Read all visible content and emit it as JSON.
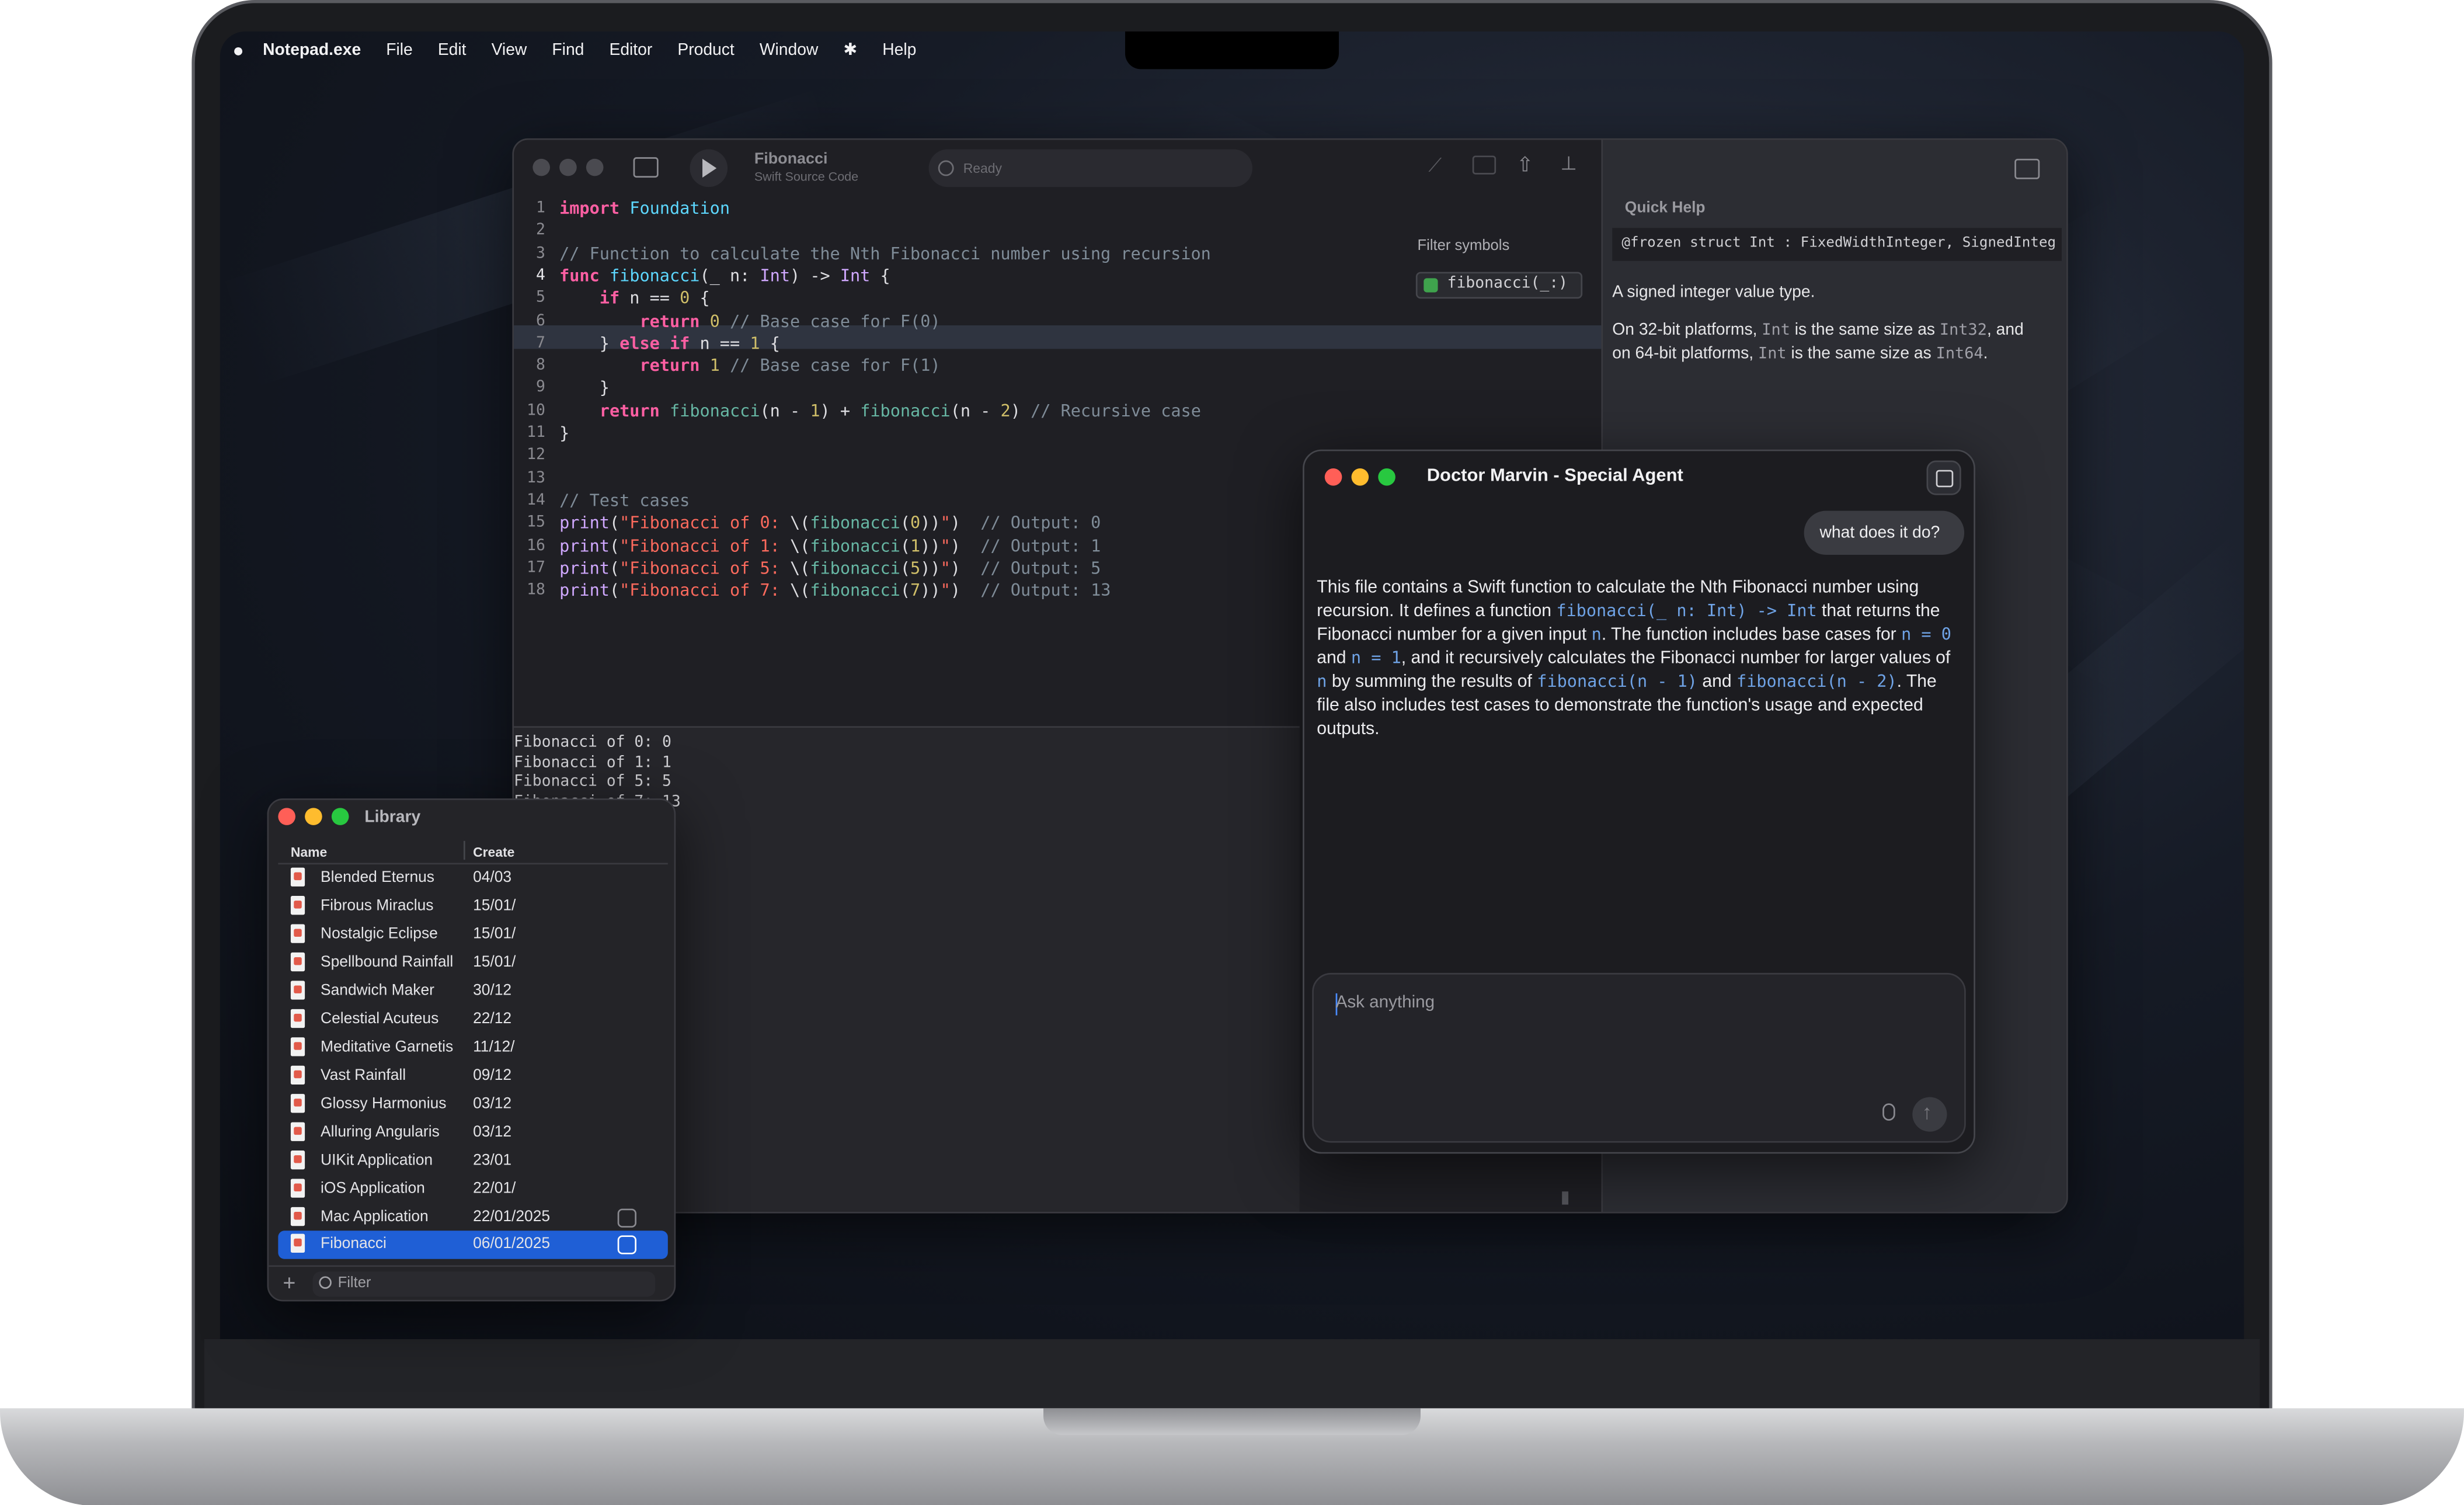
{
  "menubar": {
    "app_name": "Notepad.exe",
    "items": [
      "File",
      "Edit",
      "View",
      "Find",
      "Editor",
      "Product",
      "Window",
      "Help"
    ]
  },
  "editor": {
    "title": "Fibonacci",
    "subtitle": "Swift Source Code",
    "status": "Ready",
    "filter_symbols": "Filter symbols",
    "symbol_item": "fibonacci(_:)",
    "line_numbers": [
      "1",
      "2",
      "3",
      "4",
      "5",
      "6",
      "7",
      "8",
      "9",
      "10",
      "11",
      "12",
      "13",
      "14",
      "15",
      "16",
      "17",
      "18"
    ],
    "console_lines": [
      "Fibonacci of 0: 0",
      "Fibonacci of 1: 1",
      "Fibonacci of 5: 5",
      "Fibonacci of 7: 13"
    ]
  },
  "quick_help": {
    "title": "Quick Help",
    "declaration": "@frozen struct Int : FixedWidthInteger, SignedInteg",
    "summary": "A signed integer value type.",
    "d1": "On 32-bit platforms, ",
    "d_int": "Int",
    "d2": " is the same size as ",
    "d_int32": "Int32",
    "d3": ", and",
    "d4": "on 64-bit platforms, ",
    "d5": " is the same size as ",
    "d_int64": "Int64",
    "d6": "."
  },
  "chat": {
    "title": "Doctor Marvin - Special Agent",
    "user_message": "what does it do?",
    "answer": {
      "t1": "This file contains a Swift function to calculate the Nth Fibonacci number using recursion. It defines a function ",
      "c1": "fibonacci(_ n: Int) -> Int",
      "t2": " that returns the Fibonacci number for a given input ",
      "c2": "n",
      "t3": ". The function includes base cases for ",
      "c3": "n = 0",
      "t4": " and ",
      "c4": "n = 1",
      "t5": ", and it recursively calculates the Fibonacci number for larger values of ",
      "c5": "n",
      "t6": " by summing the results of ",
      "c6": "fibonacci(n - 1)",
      "t7": " and ",
      "c7": "fibonacci(n - 2)",
      "t8": ". The file also includes test cases to demonstrate the function's usage and expected outputs."
    },
    "input_placeholder": "Ask anything"
  },
  "library": {
    "title": "Library",
    "col_name": "Name",
    "col_created": "Create",
    "filter_placeholder": "Filter",
    "rows": [
      {
        "name": "Blended Eternus",
        "date": "04/03"
      },
      {
        "name": "Fibrous Miraclus",
        "date": "15/01/"
      },
      {
        "name": "Nostalgic Eclipse",
        "date": "15/01/"
      },
      {
        "name": "Spellbound Rainfall",
        "date": "15/01/"
      },
      {
        "name": "Sandwich Maker",
        "date": "30/12"
      },
      {
        "name": "Celestial Acuteus",
        "date": "22/12"
      },
      {
        "name": "Meditative Garnetis",
        "date": "11/12/"
      },
      {
        "name": "Vast Rainfall",
        "date": "09/12"
      },
      {
        "name": "Glossy Harmonius",
        "date": "03/12"
      },
      {
        "name": "Alluring Angularis",
        "date": "03/12"
      },
      {
        "name": "UIKit Application",
        "date": "23/01"
      },
      {
        "name": "iOS Application",
        "date": "22/01/"
      },
      {
        "name": "Mac Application",
        "date": "22/01/2025"
      },
      {
        "name": "Fibonacci",
        "date": "06/01/2025"
      }
    ]
  },
  "colors": {
    "accent": "#1f5fd6",
    "close": "#ff5f57",
    "minimize": "#febc2e",
    "zoom": "#28c840",
    "keyword": "#fc5fa3",
    "type": "#5dd8ff",
    "comment": "#7f8c98"
  }
}
